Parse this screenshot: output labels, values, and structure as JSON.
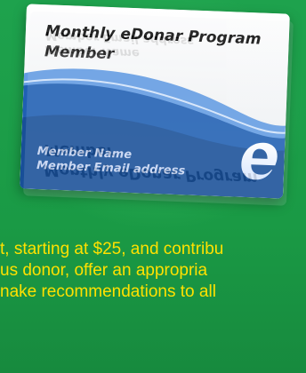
{
  "card": {
    "title": "Monthly eDonar Program",
    "subtitle": "Member",
    "member_name": "Member Name",
    "member_email": "Member Email address",
    "logo_letter": "e"
  },
  "reflection": {
    "title": "Monthly eDonar Program",
    "subtitle": "Member",
    "member_name": "Member Name",
    "member_email": "Member Email address"
  },
  "body_text": {
    "line1": "t, starting at $25, and contribu",
    "line2": "us  donor,  offer  an  appropria",
    "line3": "nake recommendations to all"
  },
  "colors": {
    "background_green": "#1a9a45",
    "text_yellow": "#ffe100",
    "card_blue": "#1f5fb3",
    "card_light_blue": "#6fa6e8"
  }
}
